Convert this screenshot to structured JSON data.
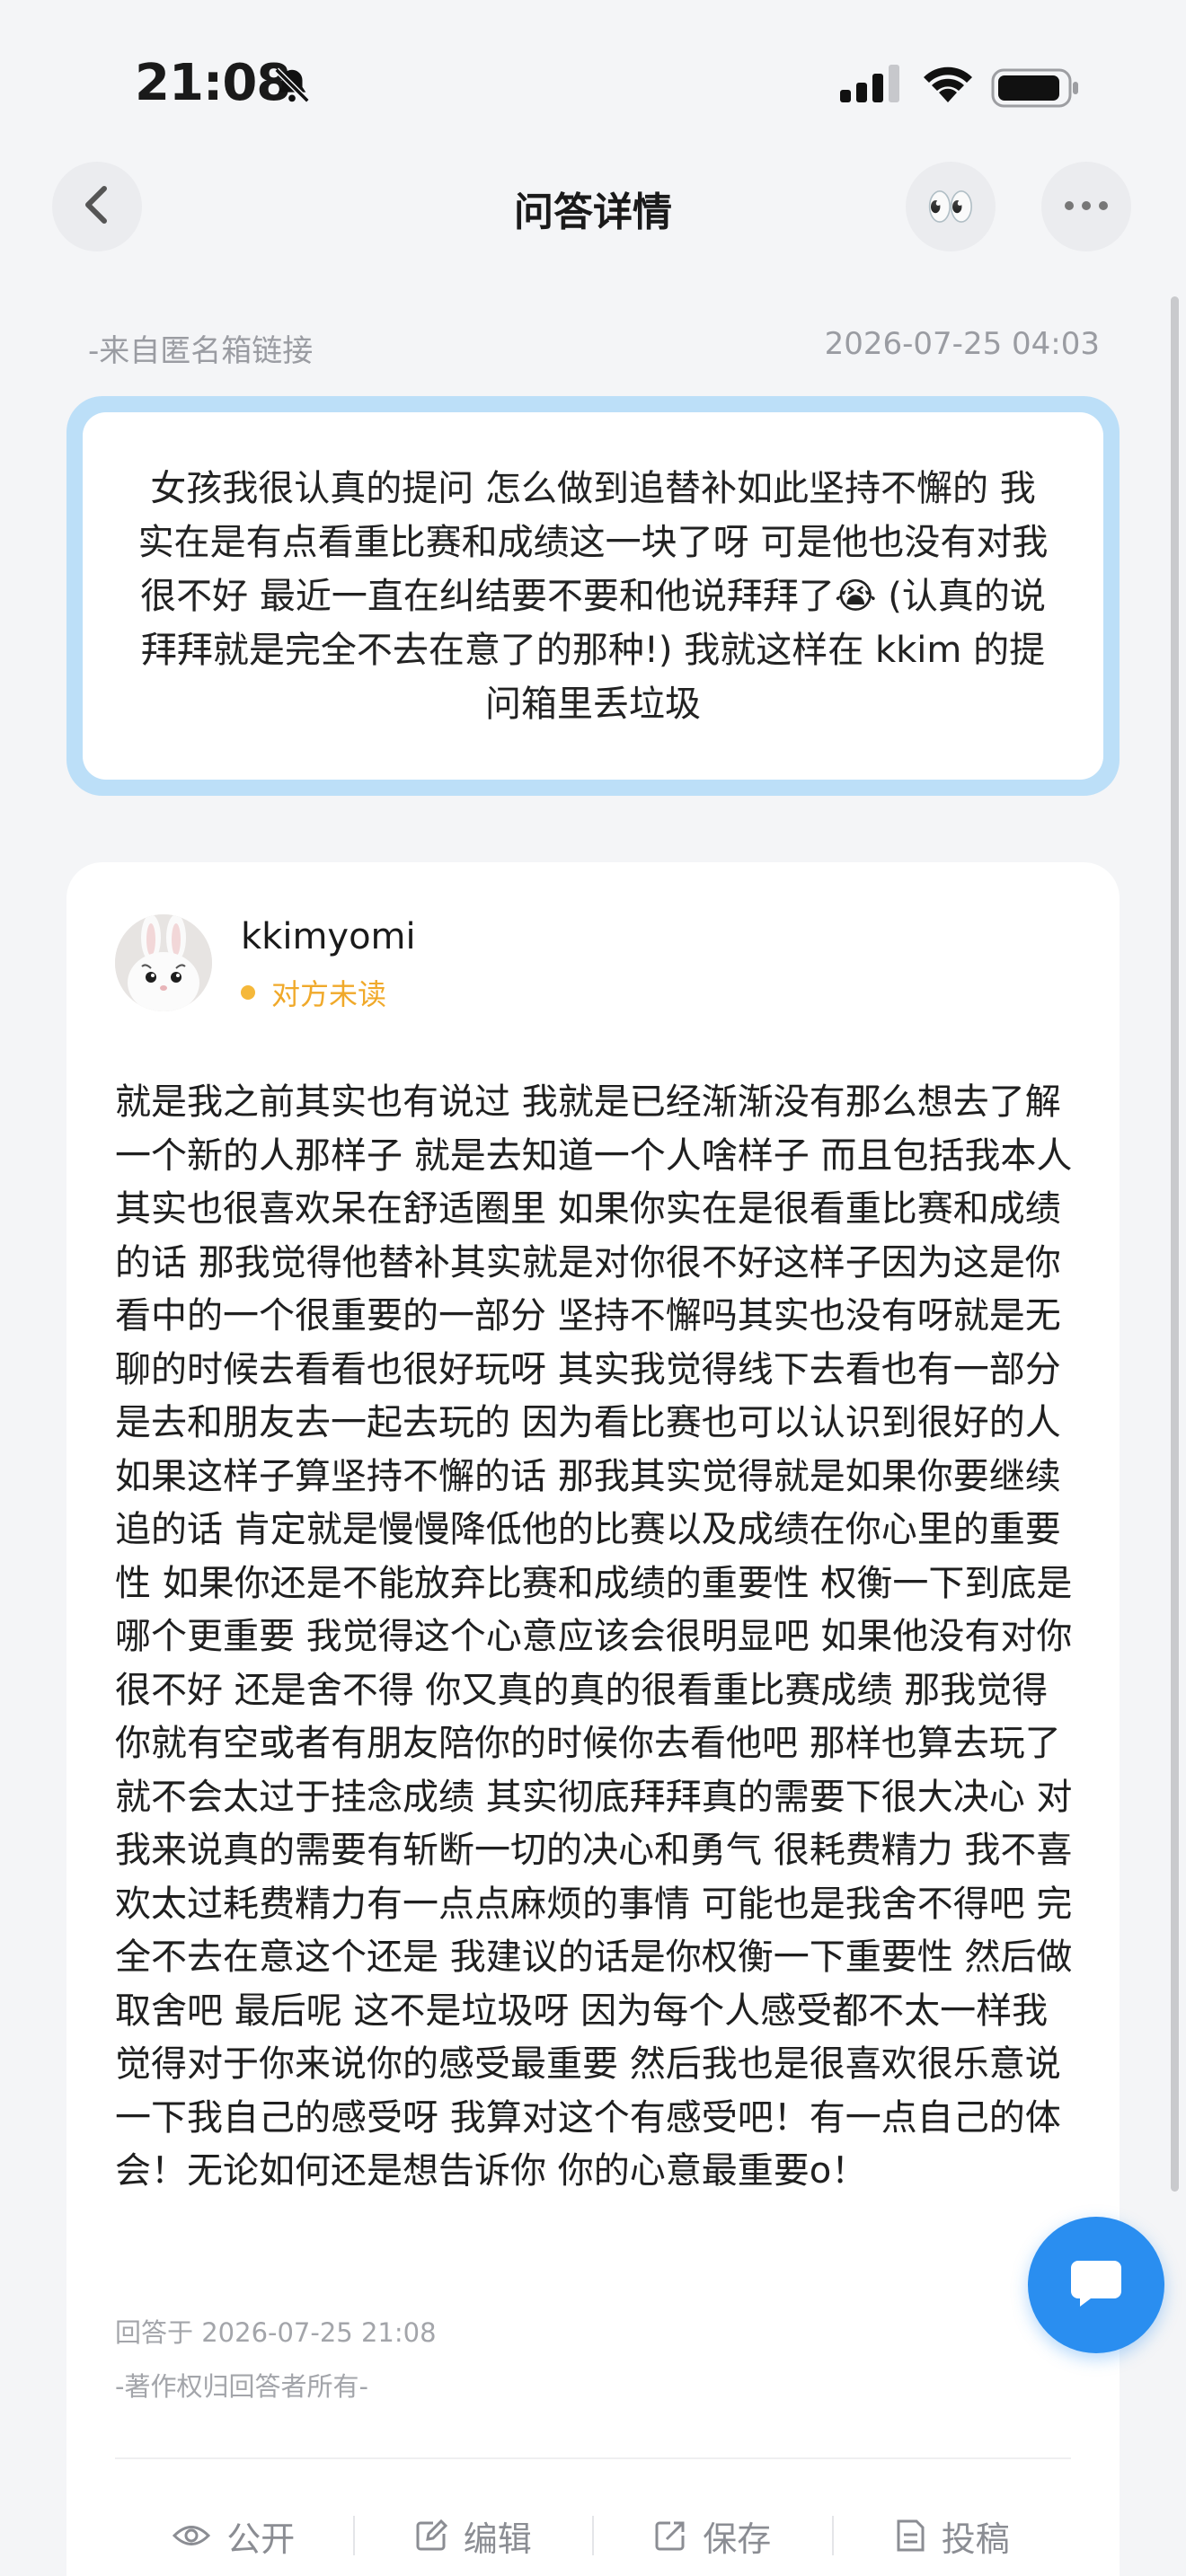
{
  "status_bar": {
    "time": "21:08",
    "icons": [
      "bell-slash-icon",
      "cellular-signal-icon",
      "wifi-icon",
      "battery-icon"
    ]
  },
  "nav": {
    "title": "问答详情",
    "back_icon": "chevron-left-icon",
    "eyes_emoji": "👀",
    "more_icon": "more-horizontal-icon"
  },
  "meta": {
    "source": "-来自匿名箱链接",
    "date": "2026-07-25 04:03"
  },
  "question": {
    "text": "女孩我很认真的提问 怎么做到追替补如此坚持不懈的 我实在是有点看重比赛和成绩这一块了呀 可是他也没有对我很不好 最近一直在纠结要不要和他说拜拜了😭 (认真的说拜拜就是完全不去在意了的那种!) 我就这样在 kkim 的提问箱里丢垃圾"
  },
  "answer": {
    "username": "kkimyomi",
    "read_status": "对方未读",
    "text": "就是我之前其实也有说过 我就是已经渐渐没有那么想去了解一个新的人那样子 就是去知道一个人啥样子 而且包括我本人其实也很喜欢呆在舒适圈里 如果你实在是很看重比赛和成绩的话 那我觉得他替补其实就是对你很不好这样子因为这是你看中的一个很重要的一部分 坚持不懈吗其实也没有呀就是无聊的时候去看看也很好玩呀 其实我觉得线下去看也有一部分是去和朋友去一起去玩的 因为看比赛也可以认识到很好的人 如果这样子算坚持不懈的话 那我其实觉得就是如果你要继续追的话 肯定就是慢慢降低他的比赛以及成绩在你心里的重要性 如果你还是不能放弃比赛和成绩的重要性 权衡一下到底是哪个更重要 我觉得这个心意应该会很明显吧 如果他没有对你很不好 还是舍不得 你又真的真的很看重比赛成绩 那我觉得你就有空或者有朋友陪你的时候你去看他吧 那样也算去玩了 就不会太过于挂念成绩 其实彻底拜拜真的需要下很大决心 对我来说真的需要有斩断一切的决心和勇气 很耗费精力 我不喜欢太过耗费精力有一点点麻烦的事情 可能也是我舍不得吧 完全不去在意这个还是 我建议的话是你权衡一下重要性 然后做取舍吧 最后呢 这不是垃圾呀 因为每个人感受都不太一样我觉得对于你来说你的感受最重要 然后我也是很喜欢很乐意说一下我自己的感受呀 我算对这个有感受吧！有一点自己的体会！无论如何还是想告诉你 你的心意最重要o！",
    "answered_at": "回答于 2026-07-25 21:08",
    "copyright": "-著作权归回答者所有-"
  },
  "actions": [
    {
      "label": "公开",
      "icon": "eye-icon"
    },
    {
      "label": "编辑",
      "icon": "edit-icon"
    },
    {
      "label": "保存",
      "icon": "share-icon"
    },
    {
      "label": "投稿",
      "icon": "document-icon"
    }
  ],
  "fab": {
    "icon": "chat-bubble-icon"
  },
  "colors": {
    "accent_blue": "#2a8ef0",
    "question_border": "#bcdff8",
    "unread_orange": "#f0a92a",
    "background": "#f4f5f7"
  }
}
